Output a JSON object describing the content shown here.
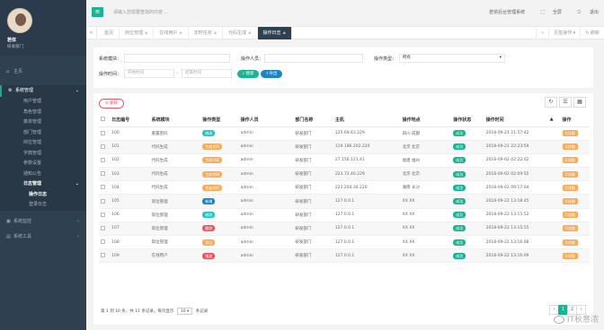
{
  "profile": {
    "name": "若依",
    "dept": "研发部门"
  },
  "sidebar": {
    "home": "主页",
    "system": "系统管理",
    "system_items": [
      "用户管理",
      "角色管理",
      "菜单管理",
      "部门管理",
      "岗位管理",
      "字典管理",
      "参数设置",
      "通知公告"
    ],
    "log": "日志管理",
    "log_items": [
      "操作日志",
      "登录日志"
    ],
    "monitor": "系统监控",
    "tools": "系统工具"
  },
  "topbar": {
    "search_placeholder": "请输入您需要查找的内容 …",
    "dev_manual": "若依后台管理系统",
    "fullscreen": "全屏",
    "logout": "退出"
  },
  "tabs": {
    "items": [
      "首页",
      "岗位管理",
      "在线用户",
      "定时任务",
      "代码生成",
      "操作日志"
    ],
    "refresh": "刷新",
    "close_ops": "页签操作"
  },
  "search": {
    "module_label": "系统模块：",
    "operator_label": "操作人员：",
    "type_label": "操作类型：",
    "type_value": "所有",
    "time_label": "操作时间：",
    "start_placeholder": "开始时间",
    "end_placeholder": "结束时间",
    "search_btn": "搜索",
    "export_btn": "导出"
  },
  "toolbar": {
    "delete": "删除"
  },
  "table": {
    "headers": [
      "日志编号",
      "系统模块",
      "操作类型",
      "操作人员",
      "部门名称",
      "主机",
      "操作地点",
      "操作状态",
      "操作时间",
      "操作"
    ],
    "rows": [
      {
        "id": "100",
        "module": "重置密码",
        "type": "修改",
        "type_color": "b-blue",
        "user": "admin",
        "dept": "研发部门",
        "host": "125.69.43.229",
        "loc": "四川 成都",
        "status": "成功",
        "time": "2018-09-21 21:57:42",
        "action": "Q详细"
      },
      {
        "id": "101",
        "module": "代码生成",
        "type": "生成代码",
        "type_color": "b-yellow",
        "user": "admin",
        "dept": "研发部门",
        "host": "119.186.202.220",
        "loc": "北京 北京",
        "status": "成功",
        "time": "2018-09-21 22:23:59",
        "action": "Q详细"
      },
      {
        "id": "102",
        "module": "代码生成",
        "type": "生成代码",
        "type_color": "b-yellow",
        "user": "admin",
        "dept": "研发部门",
        "host": "27.156.121.41",
        "loc": "福建 福州",
        "status": "成功",
        "time": "2018-09-02 02:22:02",
        "action": "Q详细"
      },
      {
        "id": "103",
        "module": "代码生成",
        "type": "生成代码",
        "type_color": "b-yellow",
        "user": "admin",
        "dept": "研发部门",
        "host": "223.72.40.229",
        "loc": "北京 北京",
        "status": "成功",
        "time": "2018-09-02 02:09:55",
        "action": "Q详细"
      },
      {
        "id": "104",
        "module": "代码生成",
        "type": "生成代码",
        "type_color": "b-yellow",
        "user": "admin",
        "dept": "研发部门",
        "host": "223.204.34.220",
        "loc": "湖南 长沙",
        "status": "成功",
        "time": "2018-09-02 09:17:04",
        "action": "Q详细"
      },
      {
        "id": "105",
        "module": "岗位管理",
        "type": "新增",
        "type_color": "b-teal",
        "user": "admin",
        "dept": "研发部门",
        "host": "127.0.0.1",
        "loc": "XX XX",
        "status": "成功",
        "time": "2018-09-22 13:18:45",
        "action": "Q详细"
      },
      {
        "id": "106",
        "module": "岗位管理",
        "type": "修改",
        "type_color": "b-blue",
        "user": "admin",
        "dept": "研发部门",
        "host": "127.0.0.1",
        "loc": "XX XX",
        "status": "成功",
        "time": "2018-09-22 13:15:52",
        "action": "Q详细"
      },
      {
        "id": "107",
        "module": "岗位管理",
        "type": "删除",
        "type_color": "b-red",
        "user": "admin",
        "dept": "研发部门",
        "host": "127.0.0.1",
        "loc": "XX XX",
        "status": "成功",
        "time": "2018-09-22 13:15:55",
        "action": "Q详细"
      },
      {
        "id": "108",
        "module": "岗位管理",
        "type": "导出",
        "type_color": "b-yellow",
        "user": "admin",
        "dept": "研发部门",
        "host": "127.0.0.1",
        "loc": "XX XX",
        "status": "成功",
        "time": "2018-09-22 13:16:08",
        "action": "Q详细"
      },
      {
        "id": "109",
        "module": "在线用户",
        "type": "强退",
        "type_color": "b-red",
        "user": "admin",
        "dept": "研发部门",
        "host": "127.0.0.1",
        "loc": "XX XX",
        "status": "成功",
        "time": "2018-09-22 13:16:09",
        "action": "Q详细"
      }
    ]
  },
  "pagination": {
    "summary": "第 1 到 10 条，共 11 条记录。每页显示",
    "page_size": "10",
    "suffix": "条记录",
    "pages": [
      "‹",
      "1",
      "2",
      "›"
    ]
  },
  "watermark": "IT秋意浓"
}
